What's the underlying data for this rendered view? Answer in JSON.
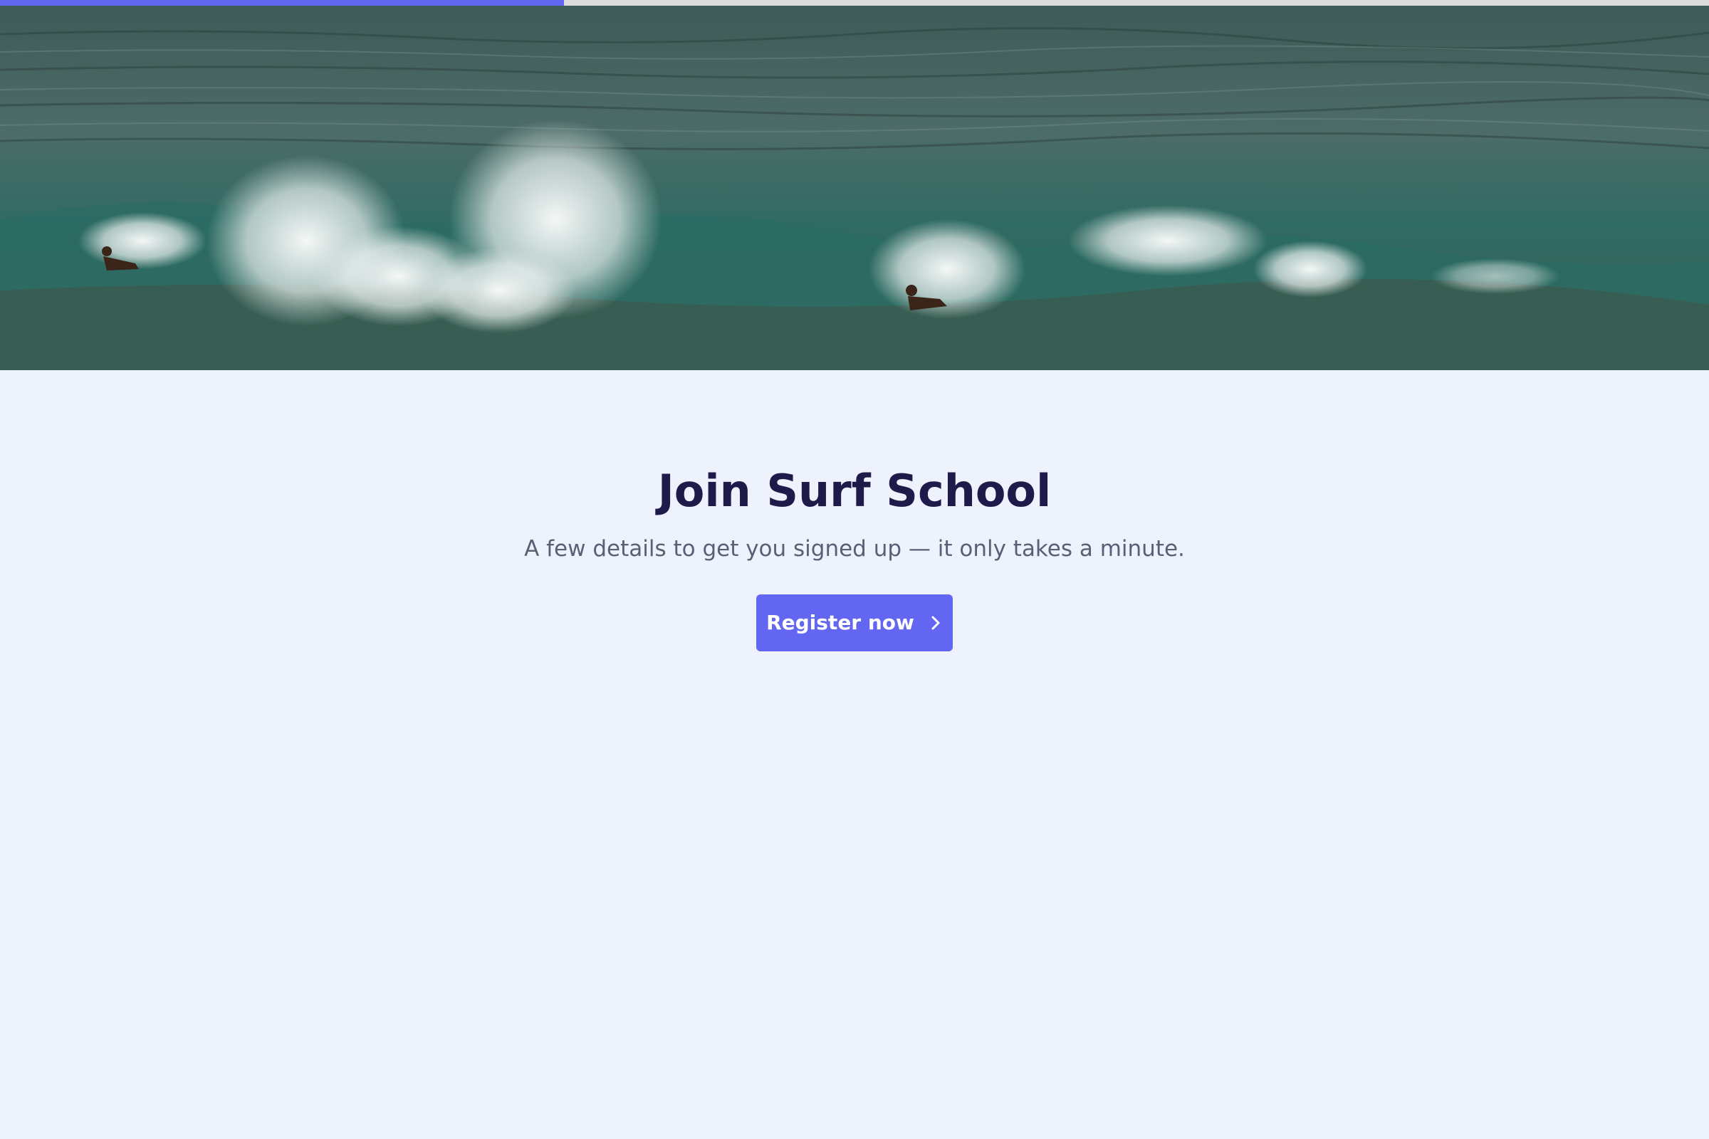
{
  "progress": {
    "value_fraction": 0.33,
    "fill_color": "#6366f1",
    "track_color": "#dcdcdc"
  },
  "hero": {
    "image": "ocean-waves-surfers"
  },
  "main": {
    "title": "Join Surf School",
    "subtitle": "A few details to get you signed up — it only takes a minute.",
    "cta_label": "Register now",
    "cta_icon": "chevron-right-icon"
  },
  "colors": {
    "accent": "#6366f1",
    "background": "#eef2fd",
    "title": "#1e1b4b",
    "subtitle": "#5b5f75"
  }
}
